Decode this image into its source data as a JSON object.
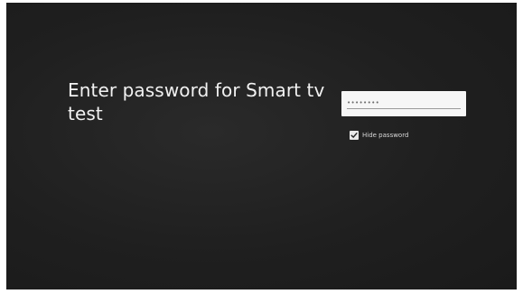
{
  "prompt": {
    "title": "Enter password for Smart tv test"
  },
  "password_field": {
    "value": "••••••••"
  },
  "hide_password": {
    "label": "Hide password",
    "checked": true
  },
  "colors": {
    "background": "#1f1f1f",
    "text": "#f1f1f1",
    "field": "#f6f6f6"
  }
}
